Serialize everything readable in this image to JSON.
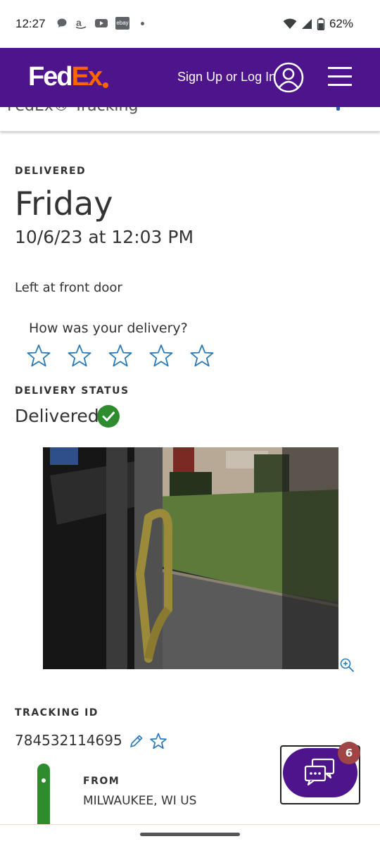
{
  "status_bar": {
    "time": "12:27",
    "battery": "62%",
    "notification_icons": [
      "chat-bubble-icon",
      "amazon-icon",
      "youtube-icon",
      "ebay-icon",
      "dot-icon"
    ],
    "ebay_text": "ebay"
  },
  "header": {
    "logo_fed": "Fed",
    "logo_ex": "Ex",
    "sign_in_label": "Sign Up or Log In",
    "brand_color": "#4d148c",
    "accent_color": "#ff6600"
  },
  "subbar": {
    "title": "FedEx® Tracking"
  },
  "delivery": {
    "status_label": "DELIVERED",
    "day": "Friday",
    "datetime": "10/6/23 at 12:03 PM",
    "location": "Left at front door"
  },
  "rating": {
    "question": "How was your delivery?",
    "max_stars": 5,
    "selected_stars": 0
  },
  "delivery_status": {
    "label": "DELIVERY STATUS",
    "value": "Delivered",
    "status_color": "#2e8b2e"
  },
  "tracking": {
    "label": "TRACKING ID",
    "id": "784532114695"
  },
  "from": {
    "label": "FROM",
    "value": "MILWAUKEE, WI US"
  },
  "chat": {
    "badge_count": "6"
  }
}
